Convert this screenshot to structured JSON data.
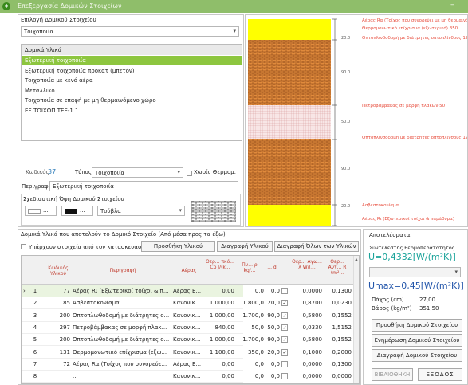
{
  "window": {
    "title": "Επεξεργασία Δομικών Στοιχείων",
    "minimize": "–"
  },
  "element_select": {
    "label": "Επιλογή Δομικού Στοιχείου",
    "value": "Τοιχοποιία",
    "arrow": "▾"
  },
  "materials_list": {
    "header": "Δομικά Υλικά",
    "items": [
      "Εξωτερική τοιχοποιία",
      "Εξωτερική τοιχοποιία προκατ (μπετόν)",
      "Τοιχοποιία με κενό αέρα",
      "Μεταλλικό",
      "Τοιχοποιία σε επαφή με μη θερμαινόμενο χώρο",
      "ΕΞ.ΤΟΙΧΟΠ.ΤΕΕ-1.1"
    ],
    "selected": 0
  },
  "details": {
    "code_label": "Κωδικός",
    "code_value": "37",
    "type_label": "Τύπος",
    "type_value": "Τοιχοποιία",
    "no_thermal_label": "Χωρίς Θερμομ.",
    "description_label": "Περιγραφή",
    "description_value": "Εξωτερική τοιχοποιία",
    "design_label": "Σχεδιαστική Όψη Δομικού Στοιχείου",
    "color1": "...",
    "color2": "...",
    "brick_value": "Τούβλα"
  },
  "diagram": {
    "dims": [
      "20.0",
      "90.0",
      "50.0",
      "90.0",
      "20.0"
    ],
    "labels": [
      "Αέρας Rα (Τοίχος που συνορεύει με μη θερμαινόμενο...",
      "Θερμομονωτικό επίχρισμα (εξωτερικό) 350",
      "Οπτοπλινθοδομή με διάτρητες οπτοπλίνθους 170",
      "Πετροβάμβακας σε μορφή πλακών 50",
      "Οπτοπλινθοδομή με διάτρητες οπτοπλίνθους 170",
      "Ασβεστοκονίαμα",
      "Αέρας Rι (Εξωτερικοί τοίχοι & παράθυρα)"
    ]
  },
  "table_section": {
    "title": "Δομικά Υλικά που αποτελούν το Δομικό Στοιχείο (Από μέσα προς τα έξω)",
    "existing_label": "Υπάρχουν στοιχεία από τον κατασκευαστή",
    "add_button": "Προσθήκη Υλικού",
    "delete_button": "Διαγραφή Υλικού",
    "delete_all_button": "Διαγραφή Όλων των Υλικών",
    "columns": [
      "Κωδικός Υλικού",
      "Περιγραφή",
      "Αέρας",
      "Θερ... πκό... Cp J/(k...",
      "Πυ... ρ kg/...",
      "... d",
      "",
      "Θερ... Αγω... λ W/(...",
      "Θερ... Αντ... R (m²..."
    ],
    "rows": [
      [
        "1",
        "77",
        "Αέρας Rι (Εξωτερικοί τοίχοι & π...",
        "Αέρας Ε...",
        "0,00",
        "0,0",
        "0,0",
        "",
        "0,0000",
        "0,1300"
      ],
      [
        "2",
        "85",
        "Ασβεστοκονίαμα",
        "Κανονικ...",
        "1.000,00",
        "1.800,0",
        "20,0",
        "✓",
        "0,8700",
        "0,0230"
      ],
      [
        "3",
        "200",
        "Οπτοπλινθοδομή με διάτρητες ο...",
        "Κανονικ...",
        "1.000,00",
        "1.700,0",
        "90,0",
        "✓",
        "0,5800",
        "0,1552"
      ],
      [
        "4",
        "297",
        "Πετροβάμβακας σε μορφή πλακ...",
        "Κανονικ...",
        "840,00",
        "50,0",
        "50,0",
        "✓",
        "0,0330",
        "1,5152"
      ],
      [
        "5",
        "200",
        "Οπτοπλινθοδομή με διάτρητες ο...",
        "Κανονικ...",
        "1.000,00",
        "1.700,0",
        "90,0",
        "✓",
        "0,5800",
        "0,1552"
      ],
      [
        "6",
        "131",
        "Θερμομονωτικό επίχρισμα (εξω...",
        "Κανονικ...",
        "1.100,00",
        "350,0",
        "20,0",
        "✓",
        "0,1000",
        "0,2000"
      ],
      [
        "7",
        "72",
        "Αέρας Rα (Τοίχος που συνορεύε...",
        "Αέρας Ε...",
        "0,00",
        "0,0",
        "0,0",
        "",
        "0,0000",
        "0,1300"
      ],
      [
        "8",
        "",
        "...",
        "Κανονικ...",
        "0,00",
        "0,0",
        "0,0",
        "",
        "0,0000",
        "0,0000"
      ]
    ]
  },
  "results": {
    "title": "Αποτελέσματα",
    "u_label": "Συντελεστής θερμοπερατότητος",
    "u_value": "U=0,4332[W/(m²K)]",
    "umax_value": "Umax=0,45[W/(m²K)]",
    "thickness_label": "Πάχος (cm)",
    "thickness_value": "27,00",
    "weight_label": "Βάρος (kg/m²)",
    "weight_value": "351,50",
    "add_button": "Προσθήκη Δομικού Στοιχείου",
    "update_button": "Ενημέρωση Δομικού Στοιχείου",
    "delete_button": "Διαγραφή Δομικού Στοιχείου",
    "library_button": "ΒΙΒΛΙΟΘΗΚΗ",
    "exit_button": "ΕΞΟΔΟΣ"
  },
  "colors": {
    "titlebar": "#8fbe6a",
    "selected": "#8dc63f",
    "yellow": "#ffff00",
    "brick": "#e08a3c",
    "insulation": "#f6d8d8",
    "teal": "#1aa39a",
    "blue": "#2255aa"
  }
}
